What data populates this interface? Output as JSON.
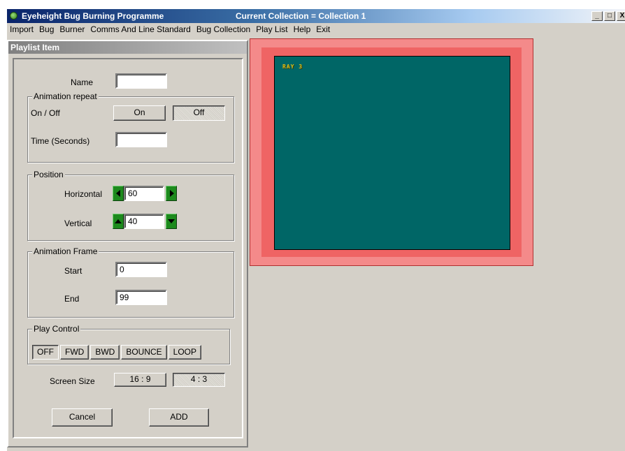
{
  "colors": {
    "title_start": "#0a246a",
    "window_face": "#d4d0c8",
    "preview_outer": "#f48a8a",
    "preview_inner": "#ef6464",
    "preview_screen": "#006666",
    "arrow_green": "#1d8a1d"
  },
  "window": {
    "title": "Eyeheight Bug Burning Programme",
    "collection_label": "Current Collection = Collection 1",
    "app_icon": "bug-app-icon",
    "controls": {
      "minimize": "_",
      "maximize": "□",
      "close": "X"
    }
  },
  "menubar": {
    "items": [
      "Import",
      "Bug",
      "Burner",
      "Comms And Line Standard",
      "Bug Collection",
      "Play List",
      "Help",
      "Exit"
    ]
  },
  "panel": {
    "title": "Playlist Item",
    "name_label": "Name",
    "name_value": "",
    "animation_repeat": {
      "group_label": "Animation repeat",
      "on_off_label": "On / Off",
      "on_label": "On",
      "off_label": "Off",
      "selected": "Off",
      "time_label": "Time (Seconds)",
      "time_value": ""
    },
    "position": {
      "group_label": "Position",
      "horizontal_label": "Horizontal",
      "horizontal_value": "60",
      "vertical_label": "Vertical",
      "vertical_value": "40"
    },
    "animation_frame": {
      "group_label": "Animation Frame",
      "start_label": "Start",
      "start_value": "0",
      "end_label": "End",
      "end_value": "99"
    },
    "play_control": {
      "group_label": "Play Control",
      "options": [
        "OFF",
        "FWD",
        "BWD",
        "BOUNCE",
        "LOOP"
      ],
      "selected": "OFF"
    },
    "screen_size": {
      "label": "Screen Size",
      "option_wide": "16 : 9",
      "option_std": "4 : 3",
      "selected": "4 : 3"
    },
    "cancel_label": "Cancel",
    "add_label": "ADD"
  },
  "preview": {
    "bug_text": "RAY 3"
  }
}
